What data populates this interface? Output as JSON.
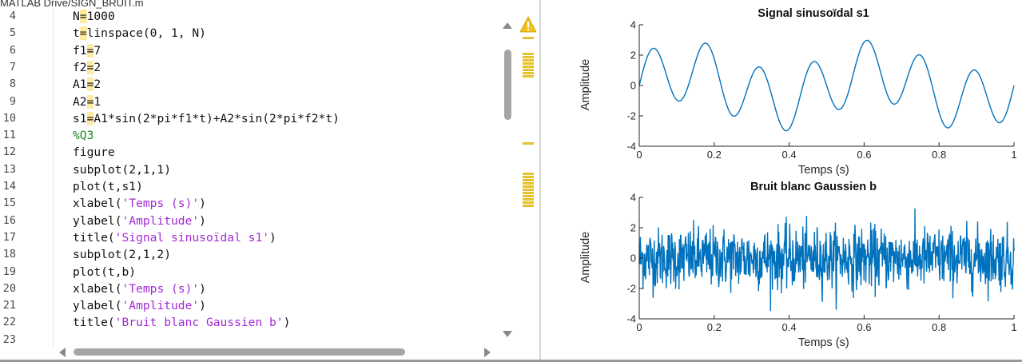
{
  "editor": {
    "path": "MATLAB Drive/SIGN_BRUIT.m",
    "lines": [
      {
        "num": "4",
        "segments": [
          [
            "N"
          ],
          [
            "=",
            "eq"
          ],
          [
            "1000"
          ]
        ]
      },
      {
        "num": "5",
        "segments": [
          [
            "t"
          ],
          [
            "=",
            "eq"
          ],
          [
            "linspace(0, 1, N)"
          ]
        ]
      },
      {
        "num": "6",
        "segments": [
          [
            "f1"
          ],
          [
            "=",
            "eq"
          ],
          [
            "7"
          ]
        ]
      },
      {
        "num": "7",
        "segments": [
          [
            "f2"
          ],
          [
            "=",
            "eq"
          ],
          [
            "2"
          ]
        ]
      },
      {
        "num": "8",
        "segments": [
          [
            "A1"
          ],
          [
            "=",
            "eq"
          ],
          [
            "2"
          ]
        ]
      },
      {
        "num": "9",
        "segments": [
          [
            "A2"
          ],
          [
            "=",
            "eq"
          ],
          [
            "1"
          ]
        ]
      },
      {
        "num": "10",
        "segments": [
          [
            "s1"
          ],
          [
            "=",
            "eq"
          ],
          [
            "A1*sin(2*pi*f1*t)+A2*sin(2*pi*f2*t)"
          ]
        ]
      },
      {
        "num": "11",
        "segments": [
          [
            "%Q3",
            "cm"
          ]
        ]
      },
      {
        "num": "12",
        "segments": [
          [
            "figure"
          ]
        ]
      },
      {
        "num": "13",
        "segments": [
          [
            "subplot(2,1,1)"
          ]
        ]
      },
      {
        "num": "14",
        "segments": [
          [
            "plot(t,s1)"
          ]
        ]
      },
      {
        "num": "15",
        "segments": [
          [
            "xlabel("
          ],
          [
            "'Temps (s)'",
            "st"
          ],
          [
            ")"
          ]
        ]
      },
      {
        "num": "16",
        "segments": [
          [
            "ylabel("
          ],
          [
            "'Amplitude'",
            "st"
          ],
          [
            ")"
          ]
        ]
      },
      {
        "num": "17",
        "segments": [
          [
            "title("
          ],
          [
            "'Signal sinusoïdal s1'",
            "st"
          ],
          [
            ")"
          ]
        ]
      },
      {
        "num": "18",
        "segments": [
          [
            "subplot(2,1,2)"
          ]
        ]
      },
      {
        "num": "19",
        "segments": [
          [
            "plot(t,b)"
          ]
        ]
      },
      {
        "num": "20",
        "segments": [
          [
            "xlabel("
          ],
          [
            "'Temps (s)'",
            "st"
          ],
          [
            ")"
          ]
        ]
      },
      {
        "num": "21",
        "segments": [
          [
            "ylabel("
          ],
          [
            "'Amplitude'",
            "st"
          ],
          [
            ")"
          ]
        ]
      },
      {
        "num": "22",
        "segments": [
          [
            "title("
          ],
          [
            "'Bruit blanc Gaussien b'",
            "st"
          ],
          [
            ")"
          ]
        ]
      },
      {
        "num": "23",
        "segments": []
      }
    ],
    "warning_icon": "warning-triangle-icon",
    "colors": {
      "highlight": "#fdeaa3",
      "comment": "#1e8a1e",
      "string": "#a22ad4",
      "warning": "#e8c22c"
    }
  },
  "figure": {
    "line_color": "#0072bd",
    "subplots": [
      {
        "title": "Signal sinusoïdal s1",
        "xlabel": "Temps (s)",
        "ylabel": "Amplitude"
      },
      {
        "title": "Bruit blanc Gaussien b",
        "xlabel": "Temps (s)",
        "ylabel": "Amplitude"
      }
    ]
  },
  "chart_data": [
    {
      "type": "line",
      "title": "Signal sinusoïdal s1",
      "xlabel": "Temps (s)",
      "ylabel": "Amplitude",
      "xlim": [
        0,
        1
      ],
      "ylim": [
        -4,
        4
      ],
      "xticks": [
        "0",
        "0.2",
        "0.4",
        "0.6",
        "0.8",
        "1"
      ],
      "yticks": [
        "4",
        "2",
        "0",
        "-2",
        "-4"
      ],
      "series": [
        {
          "formula": "2*sin(2*pi*7*t) + 1*sin(2*pi*2*t)",
          "f1": 7,
          "f2": 2,
          "A1": 2,
          "A2": 1,
          "N": 1000
        }
      ]
    },
    {
      "type": "line",
      "title": "Bruit blanc Gaussien b",
      "xlabel": "Temps (s)",
      "ylabel": "Amplitude",
      "xlim": [
        0,
        1
      ],
      "ylim": [
        -4,
        4
      ],
      "xticks": [
        "0",
        "0.2",
        "0.4",
        "0.6",
        "0.8",
        "1"
      ],
      "yticks": [
        "4",
        "2",
        "0",
        "-2",
        "-4"
      ],
      "series": [
        {
          "distribution": "gaussian",
          "mean": 0,
          "std": 1,
          "N": 1000
        }
      ]
    }
  ]
}
